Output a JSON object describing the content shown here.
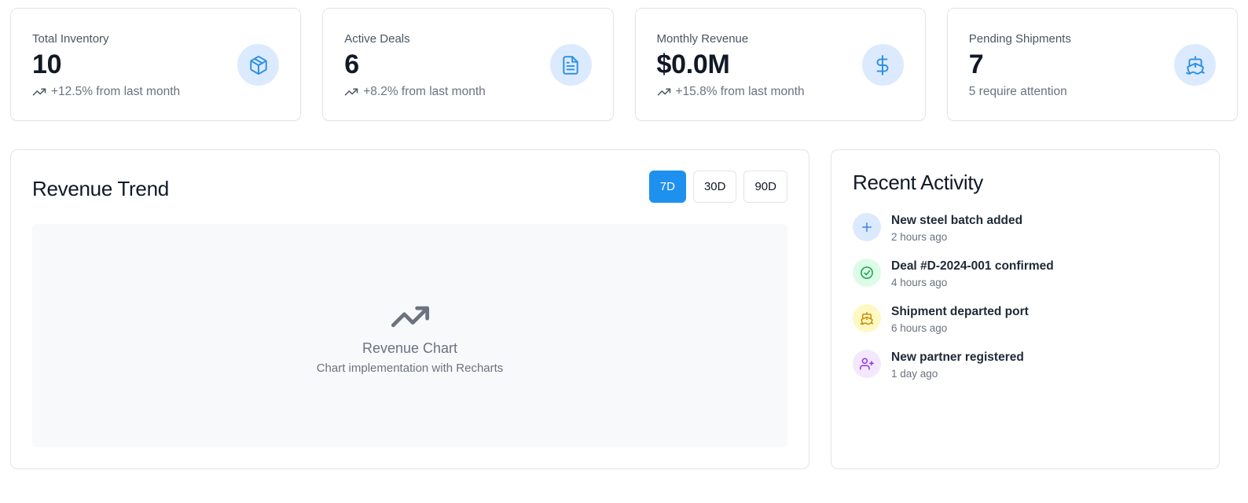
{
  "stats": [
    {
      "label": "Total Inventory",
      "value": "10",
      "sub": "+12.5% from last month",
      "icon": "package-icon"
    },
    {
      "label": "Active Deals",
      "value": "6",
      "sub": "+8.2% from last month",
      "icon": "file-text-icon"
    },
    {
      "label": "Monthly Revenue",
      "value": "$0.0M",
      "sub": "+15.8% from last month",
      "icon": "dollar-icon"
    },
    {
      "label": "Pending Shipments",
      "value": "7",
      "sub": "5 require attention",
      "icon": "ship-icon"
    }
  ],
  "revenue": {
    "title": "Revenue Trend",
    "ranges": [
      "7D",
      "30D",
      "90D"
    ],
    "active_range": "7D",
    "placeholder_title": "Revenue Chart",
    "placeholder_sub": "Chart implementation with Recharts"
  },
  "activity": {
    "title": "Recent Activity",
    "items": [
      {
        "title": "New steel batch added",
        "time": "2 hours ago",
        "icon": "plus-icon",
        "color": "#3b82f6",
        "bg": "#dbeafe"
      },
      {
        "title": "Deal #D-2024-001 confirmed",
        "time": "4 hours ago",
        "icon": "check-circle-icon",
        "color": "#16a34a",
        "bg": "#dcfce7"
      },
      {
        "title": "Shipment departed port",
        "time": "6 hours ago",
        "icon": "ship-icon",
        "color": "#ca8a04",
        "bg": "#fef9c3"
      },
      {
        "title": "New partner registered",
        "time": "1 day ago",
        "icon": "user-plus-icon",
        "color": "#9333ea",
        "bg": "#f3e8ff"
      }
    ]
  },
  "colors": {
    "accent": "#1e90ee",
    "icon_blue": "#2b8fe6",
    "icon_bg": "#dbeafe"
  }
}
